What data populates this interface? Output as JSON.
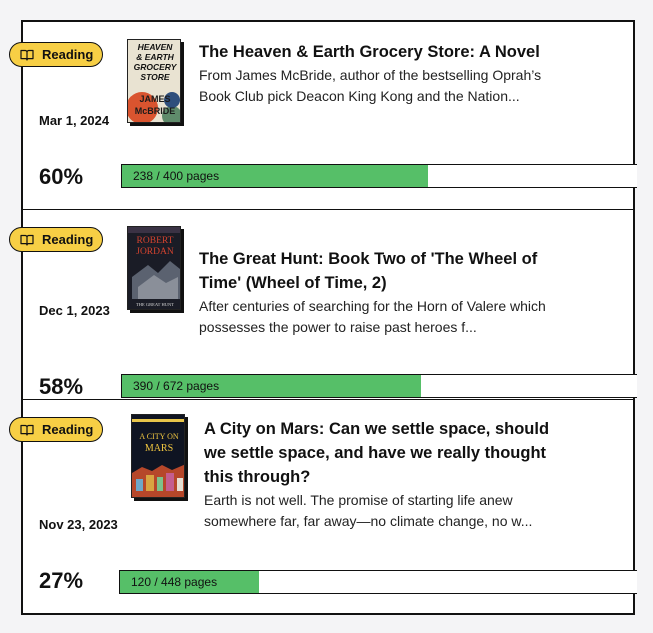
{
  "colors": {
    "badge": "#f7cf45",
    "progress_fill": "#56bf68",
    "border": "#111111"
  },
  "books": [
    {
      "status": "Reading",
      "status_icon": "book-open-icon",
      "date": "Mar 1, 2024",
      "title": "The Heaven & Earth Grocery Store: A Novel",
      "description": "From James McBride, author of the bestselling Oprah’s Book Club pick Deacon King Kong and the Nation...",
      "percent_label": "60%",
      "progress_fraction": 0.595,
      "pages_label": "238 / 400 pages",
      "cover": {
        "line1": "HEAVEN",
        "line2": "& EARTH",
        "line3": "GROCERY",
        "line4": "STORE",
        "author1": "JAMES",
        "author2": "McBRIDE"
      }
    },
    {
      "status": "Reading",
      "status_icon": "book-open-icon",
      "date": "Dec 1, 2023",
      "title": "The Great Hunt: Book Two of 'The Wheel of Time' (Wheel of Time, 2)",
      "description": "After centuries of searching for the Horn of Valere which possesses the power to raise past heroes f...",
      "percent_label": "58%",
      "progress_fraction": 0.58,
      "pages_label": "390 / 672 pages",
      "cover": {
        "author1": "ROBERT",
        "author2": "JORDAN",
        "line1": "THE GREAT HUNT"
      }
    },
    {
      "status": "Reading",
      "status_icon": "book-open-icon",
      "date": "Nov 23, 2023",
      "title": "A City on Mars: Can we settle space, should we settle space, and have we really thought this through?",
      "description": "Earth is not well. The promise of starting life anew somewhere far, far away—no climate change, no w...",
      "percent_label": "27%",
      "progress_fraction": 0.268,
      "pages_label": "120 / 448 pages",
      "cover": {
        "line1": "A CITY ON",
        "line2": "MARS"
      }
    }
  ]
}
